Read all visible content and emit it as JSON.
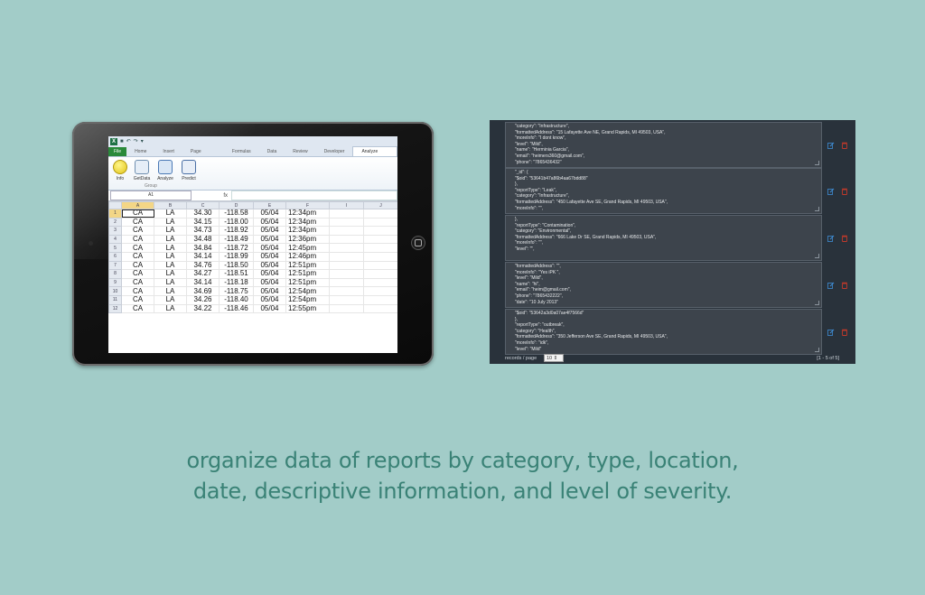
{
  "spreadsheet": {
    "quick_access": [
      "↶",
      "↷",
      "▾"
    ],
    "file_tab": "File",
    "tabs": [
      "Home",
      "Insert",
      "Page Layout",
      "Formulas",
      "Data",
      "Review",
      "Developer",
      "Analyze Data"
    ],
    "ribbon_buttons": [
      "Info",
      "GetData",
      "Analyze",
      "Predict"
    ],
    "ribbon_group": "Group",
    "name_box": "A1",
    "fx": "fx",
    "columns": [
      "A",
      "B",
      "C",
      "D",
      "E",
      "F",
      "I",
      "J"
    ],
    "rows": [
      [
        "1",
        "CA",
        "LA",
        "34.30",
        "-118.58",
        "05/04",
        "12:34pm"
      ],
      [
        "2",
        "CA",
        "LA",
        "34.15",
        "-118.00",
        "05/04",
        "12:34pm"
      ],
      [
        "3",
        "CA",
        "LA",
        "34.73",
        "-118.92",
        "05/04",
        "12:34pm"
      ],
      [
        "4",
        "CA",
        "LA",
        "34.48",
        "-118.49",
        "05/04",
        "12:36pm"
      ],
      [
        "5",
        "CA",
        "LA",
        "34.84",
        "-118.72",
        "05/04",
        "12:45pm"
      ],
      [
        "6",
        "CA",
        "LA",
        "34.14",
        "-118.99",
        "05/04",
        "12:46pm"
      ],
      [
        "7",
        "CA",
        "LA",
        "34.76",
        "-118.50",
        "05/04",
        "12:51pm"
      ],
      [
        "8",
        "CA",
        "LA",
        "34.27",
        "-118.51",
        "05/04",
        "12:51pm"
      ],
      [
        "9",
        "CA",
        "LA",
        "34.14",
        "-118.18",
        "05/04",
        "12:51pm"
      ],
      [
        "10",
        "CA",
        "LA",
        "34.69",
        "-118.75",
        "05/04",
        "12:54pm"
      ],
      [
        "11",
        "CA",
        "LA",
        "34.26",
        "-118.40",
        "05/04",
        "12:54pm"
      ],
      [
        "12",
        "CA",
        "LA",
        "34.22",
        "-118.46",
        "05/04",
        "12:55pm"
      ]
    ]
  },
  "records_panel": {
    "records": [
      {
        "lines": [
          "\"category\": \"Infrastructure\",",
          "\"formattedAddress\": \"15 Lafayette Ave NE, Grand Rapids, MI 49503, USA\",",
          "\"moreInfo\": \"I dont know\",",
          "\"level\": \"Mild\",",
          "\"name\": \"Herminia Garcia\",",
          "\"email\": \"heimers360@gmail.com\",",
          "\"phone\": \"7865436432\""
        ]
      },
      {
        "lines": [
          "\"_id\": {",
          "  \"$oid\": \"53641b47a86b4aa67bdd88\"",
          "},",
          "\"reportType\": \"Leak\",",
          "\"category\": \"Infrastructure\",",
          "\"formattedAddress\": \"450 Lafayette Ave SE, Grand Rapids, MI 49503, USA\",",
          "\"moreInfo\": \"\","
        ]
      },
      {
        "lines": [
          "},",
          "\"reportType\": \"Contamination\",",
          "\"category\": \"Environmental\",",
          "\"formattedAddress\": \"666 Lake Dr SE, Grand Rapids, MI 49503, USA\",",
          "\"moreInfo\": \"\",",
          "\"level\": \"\","
        ]
      },
      {
        "lines": [
          "\"formattedAddress\": \"\",",
          "\"moreInfo\": \"Yes iPK \",",
          "\"level\": \"Mild\",",
          "\"name\": \"hi\",",
          "\"email\": \"heim@gmail.com\",",
          "\"phone\": \"7865432222\",",
          "\"date\": \"10 July 2013\""
        ]
      },
      {
        "lines": [
          "  \"$oid\": \"53642a3d0a07ae4f7566d\"",
          "},",
          "\"reportType\": \"outbreak\",",
          "\"category\": \"Health\",",
          "\"formattedAddress\": \"350 Jefferson Ave SE, Grand Rapids, MI 49503, USA\",",
          "\"moreInfo\": \"idk\",",
          "\"level\": \"Mild\""
        ]
      }
    ],
    "footer": {
      "records_per_page_label": "records / page",
      "records_per_page_value": "10",
      "range": "[1 - 5 of 5]"
    },
    "colors": {
      "edit": "#3f8ed6",
      "delete": "#c0392b"
    }
  },
  "caption": {
    "line1": "organize data of reports by category, type, location,",
    "line2": "date, descriptive information, and level of severity."
  }
}
